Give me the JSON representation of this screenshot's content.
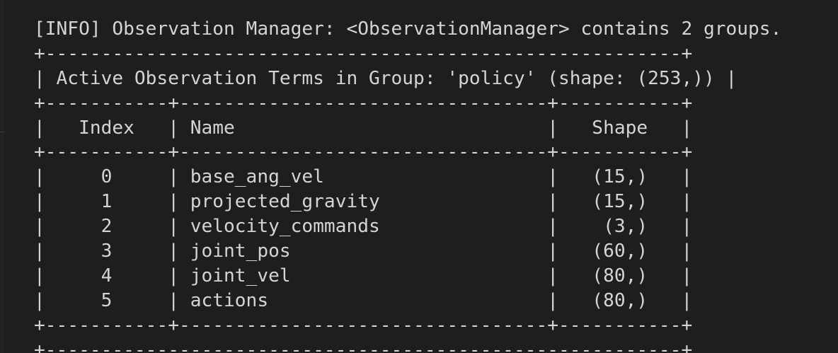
{
  "theme": {
    "background": "#1e1e1e",
    "foreground": "#d4d4d4"
  },
  "terminal": {
    "info_line": "[INFO] Observation Manager: <ObservationManager> contains 2 groups.",
    "border_top": "+---------------------------------------------------------+",
    "title_row": "| Active Observation Terms in Group: 'policy' (shape: (253,)) |",
    "border_sep": "+-----------+---------------------------------+-----------+",
    "header_row": "|   Index   | Name                            |   Shape   |",
    "rows": [
      "|     0     | base_ang_vel                    |   (15,)   |",
      "|     1     | projected_gravity               |   (15,)   |",
      "|     2     | velocity_commands               |    (3,)   |",
      "|     3     | joint_pos                       |   (60,)   |",
      "|     4     | joint_vel                       |   (80,)   |",
      "|     5     | actions                         |   (80,)   |"
    ],
    "border_bottom": "+-----------+---------------------------------+-----------+",
    "next_border": "+---------------------------------------------------------+"
  }
}
